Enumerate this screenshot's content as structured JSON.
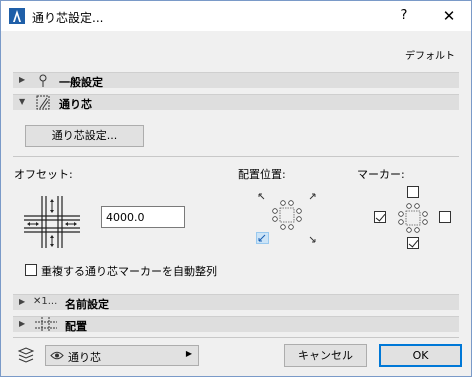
{
  "window": {
    "title": "通り芯設定...",
    "help_label": "?",
    "close_label": "✕"
  },
  "header": {
    "default_label": "デフォルト"
  },
  "sections": {
    "general": {
      "label": "一般設定",
      "icon": "pin-icon"
    },
    "grid": {
      "label": "通り芯",
      "icon": "grid-line-icon"
    },
    "naming": {
      "label": "名前設定",
      "icon": "naming-icon",
      "prefix": "✕1..."
    },
    "placement": {
      "label": "配置",
      "icon": "placement-grid-icon"
    }
  },
  "grid_settings_button": "通り芯設定...",
  "offset": {
    "label": "オフセット:",
    "value": "4000.0"
  },
  "position": {
    "label": "配置位置:"
  },
  "marker": {
    "label": "マーカー:",
    "top_checked": false,
    "left_checked": true,
    "right_checked": false,
    "bottom_checked": true
  },
  "auto_arrange": {
    "label": "重複する通り芯マーカーを自動整列",
    "checked": false
  },
  "footer": {
    "layer_dropdown": "通り芯",
    "cancel_label": "キャンセル",
    "ok_label": "OK"
  },
  "colors": {
    "accent": "#0078d7",
    "section_bar": "#dedede"
  }
}
